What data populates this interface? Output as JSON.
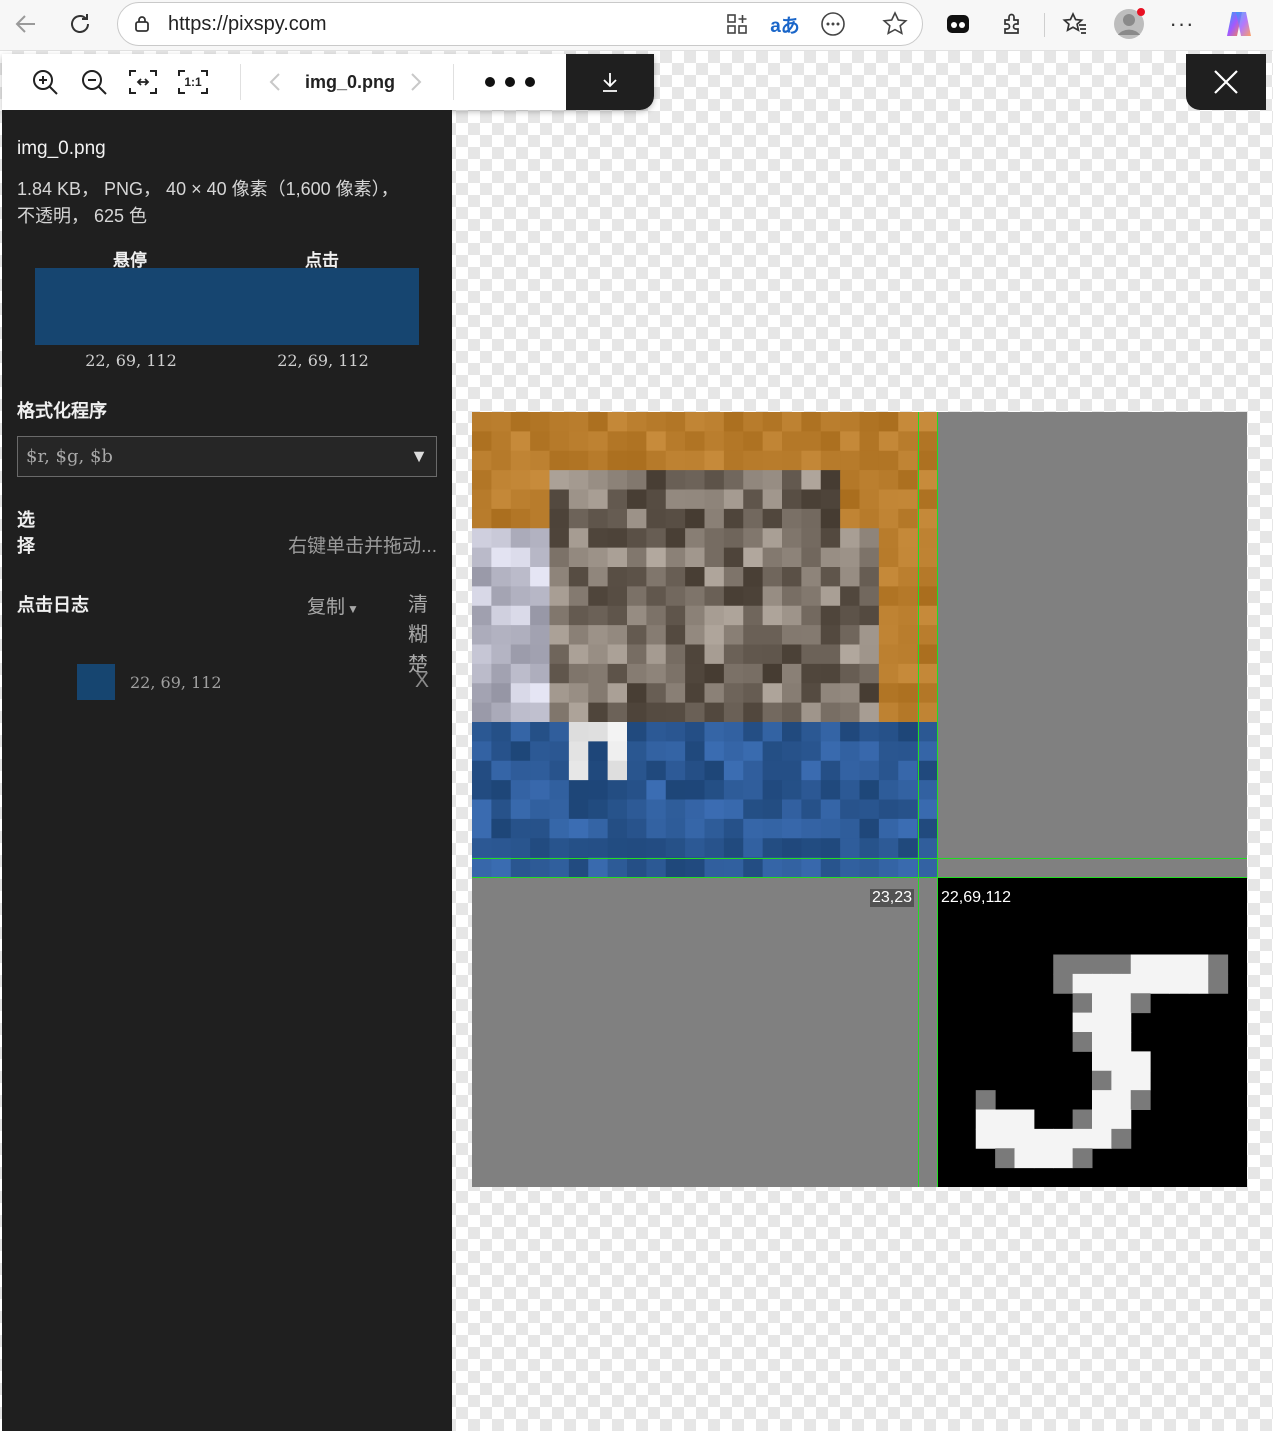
{
  "browser": {
    "url": "https://pixspy.com",
    "translate_label": "aあ"
  },
  "toolbar": {
    "file_name": "img_0.png",
    "zoom_in_icon": "zoom-in-icon",
    "zoom_out_icon": "zoom-out-icon",
    "fit_icon": "fit-screen-icon",
    "actual_size_label": "1:1"
  },
  "panel": {
    "file_name": "img_0.png",
    "meta_line1": "1.84 KB， PNG， 40 × 40 像素（1,600 像素），",
    "meta_line2": "不透明， 625 色",
    "hover_label": "悬停",
    "click_label": "点击",
    "hover_value": "22, 69, 112",
    "click_value": "22, 69, 112",
    "swatch_color": "#164570",
    "formatter_heading": "格式化程序",
    "formatter_value": "$r, $g, $b",
    "selection_label": "选择",
    "selection_hint": "右键单击并拖动...",
    "clicklog_heading": "点击日志",
    "copy_label": "复制",
    "clear_label": "清糊楚",
    "log_entries": [
      {
        "color": "#164570",
        "value": "22, 69, 112",
        "remove": "X"
      }
    ]
  },
  "stage": {
    "coord_label": "23,23",
    "color_label": "22,69,112",
    "crosshair_color": "#22dd22"
  }
}
